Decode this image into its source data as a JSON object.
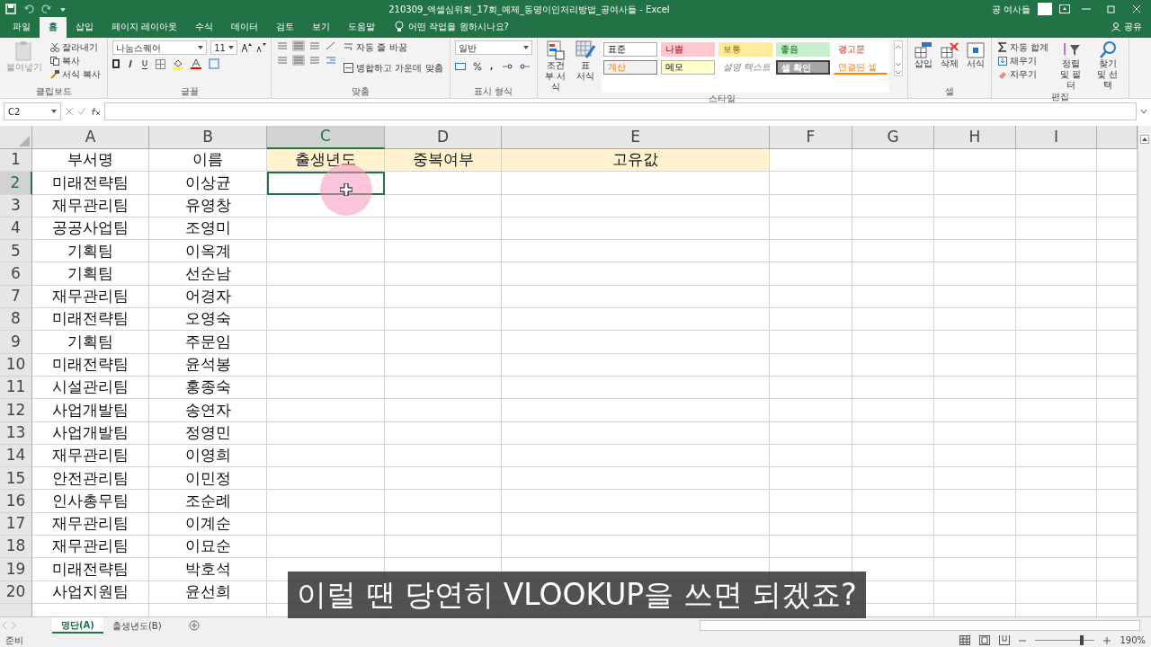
{
  "window": {
    "title": "210309_엑셀심위회_17회_예제_동명이인처리방법_공여사들 - Excel",
    "user": "공 여사들"
  },
  "ribbon_tabs": [
    {
      "label": "파일",
      "selected": false
    },
    {
      "label": "홈",
      "selected": true
    },
    {
      "label": "삽입",
      "selected": false
    },
    {
      "label": "페이지 레이아웃",
      "selected": false
    },
    {
      "label": "수식",
      "selected": false
    },
    {
      "label": "데이터",
      "selected": false
    },
    {
      "label": "검토",
      "selected": false
    },
    {
      "label": "보기",
      "selected": false
    },
    {
      "label": "도움말",
      "selected": false
    }
  ],
  "tell_me": "어떤 작업을 원하시나요?",
  "share": "공유",
  "clipboard": {
    "paste": "붙여넣기",
    "cut": "잘라내기",
    "copy": "복사",
    "format_painter": "서식 복사",
    "group": "클립보드"
  },
  "font": {
    "name": "나눔스퀘어",
    "size": "11",
    "group": "글꼴"
  },
  "alignment": {
    "wrap": "자동 줄 바꿈",
    "merge": "병합하고 가운데 맞춤",
    "group": "맞춤"
  },
  "number": {
    "format": "일반",
    "group": "표시 형식"
  },
  "styles": {
    "conditional": "조건부 서식",
    "table": "표 서식",
    "group": "스타일",
    "items": [
      {
        "label": "표준",
        "kind": "normal"
      },
      {
        "label": "나쁨",
        "kind": "bad"
      },
      {
        "label": "보통",
        "kind": "neutral"
      },
      {
        "label": "좋음",
        "kind": "good"
      },
      {
        "label": "경고문",
        "kind": "warning"
      },
      {
        "label": "계산",
        "kind": "calculation"
      },
      {
        "label": "메모",
        "kind": "note"
      },
      {
        "label": "설명 텍스트",
        "kind": "explanatory"
      },
      {
        "label": "셀 확인",
        "kind": "check"
      },
      {
        "label": "연결된 셀",
        "kind": "linked"
      }
    ]
  },
  "cells_group": {
    "insert": "삽입",
    "delete": "삭제",
    "format": "서식",
    "group": "셀"
  },
  "editing": {
    "autosum": "자동 합계",
    "fill": "채우기",
    "clear": "지우기",
    "sort": "정렬 및 필터",
    "find": "찾기 및 선택",
    "group": "편집"
  },
  "name_box": "C2",
  "columns": [
    {
      "label": "A",
      "selected": false
    },
    {
      "label": "B",
      "selected": false
    },
    {
      "label": "C",
      "selected": true
    },
    {
      "label": "D",
      "selected": false
    },
    {
      "label": "E",
      "selected": false
    },
    {
      "label": "F",
      "selected": false
    },
    {
      "label": "G",
      "selected": false
    },
    {
      "label": "H",
      "selected": false
    },
    {
      "label": "I",
      "selected": false
    }
  ],
  "rows": [
    {
      "number": "1",
      "selected": false,
      "cells": [
        {
          "text": "부서명"
        },
        {
          "text": "이름"
        },
        {
          "text": "출생년도",
          "color": "#fff2cc"
        },
        {
          "text": "중복여부",
          "color": "#fff2cc"
        },
        {
          "text": "고유값",
          "color": "#fff2cc"
        }
      ]
    },
    {
      "number": "2",
      "selected": true,
      "cells": [
        {
          "text": "미래전략팀"
        },
        {
          "text": "이상균"
        }
      ]
    },
    {
      "number": "3",
      "selected": false,
      "cells": [
        {
          "text": "재무관리팀"
        },
        {
          "text": "유영창"
        }
      ]
    },
    {
      "number": "4",
      "selected": false,
      "cells": [
        {
          "text": "공공사업팀"
        },
        {
          "text": "조영미"
        }
      ]
    },
    {
      "number": "5",
      "selected": false,
      "cells": [
        {
          "text": "기획팀"
        },
        {
          "text": "이옥계"
        }
      ]
    },
    {
      "number": "6",
      "selected": false,
      "cells": [
        {
          "text": "기획팀"
        },
        {
          "text": "선순남"
        }
      ]
    },
    {
      "number": "7",
      "selected": false,
      "cells": [
        {
          "text": "재무관리팀"
        },
        {
          "text": "어경자"
        }
      ]
    },
    {
      "number": "8",
      "selected": false,
      "cells": [
        {
          "text": "미래전략팀"
        },
        {
          "text": "오영숙"
        }
      ]
    },
    {
      "number": "9",
      "selected": false,
      "cells": [
        {
          "text": "기획팀"
        },
        {
          "text": "주문임"
        }
      ]
    },
    {
      "number": "10",
      "selected": false,
      "cells": [
        {
          "text": "미래전략팀"
        },
        {
          "text": "윤석봉"
        }
      ]
    },
    {
      "number": "11",
      "selected": false,
      "cells": [
        {
          "text": "시설관리팀"
        },
        {
          "text": "홍종숙"
        }
      ]
    },
    {
      "number": "12",
      "selected": false,
      "cells": [
        {
          "text": "사업개발팀"
        },
        {
          "text": "송연자"
        }
      ]
    },
    {
      "number": "13",
      "selected": false,
      "cells": [
        {
          "text": "사업개발팀"
        },
        {
          "text": "정영민"
        }
      ]
    },
    {
      "number": "14",
      "selected": false,
      "cells": [
        {
          "text": "재무관리팀"
        },
        {
          "text": "이영희"
        }
      ]
    },
    {
      "number": "15",
      "selected": false,
      "cells": [
        {
          "text": "안전관리팀"
        },
        {
          "text": "이민정"
        }
      ]
    },
    {
      "number": "16",
      "selected": false,
      "cells": [
        {
          "text": "인사총무팀"
        },
        {
          "text": "조순례"
        }
      ]
    },
    {
      "number": "17",
      "selected": false,
      "cells": [
        {
          "text": "재무관리팀"
        },
        {
          "text": "이계순"
        }
      ]
    },
    {
      "number": "18",
      "selected": false,
      "cells": [
        {
          "text": "재무관리팀"
        },
        {
          "text": "이묘순"
        }
      ]
    },
    {
      "number": "19",
      "selected": false,
      "cells": [
        {
          "text": "미래전략팀"
        },
        {
          "text": "박호석"
        }
      ]
    },
    {
      "number": "20",
      "selected": false,
      "cells": [
        {
          "text": "사업지원팀"
        },
        {
          "text": "윤선희"
        }
      ]
    }
  ],
  "sheets": [
    {
      "label": "명단(A)",
      "selected": true
    },
    {
      "label": "출생년도(B)",
      "selected": false
    }
  ],
  "status": "준비",
  "zoom": {
    "reading": "190%",
    "level": 0.78
  },
  "subtitle": "이럴 땐 당연히 VLOOKUP을 쓰면 되겠죠?"
}
